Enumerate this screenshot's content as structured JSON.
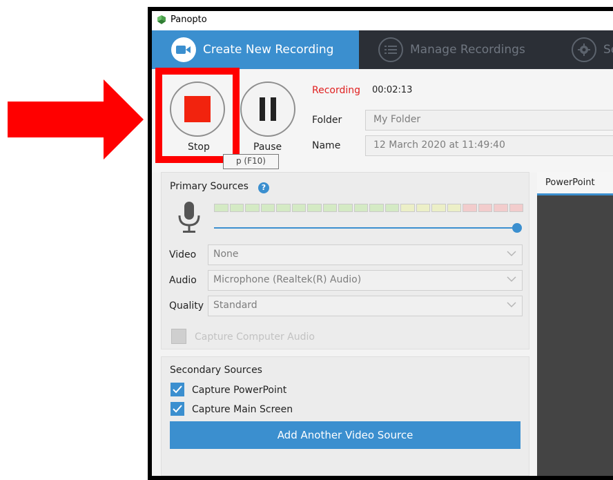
{
  "app": {
    "title": "Panopto"
  },
  "tabs": [
    {
      "label": "Create New Recording",
      "icon": "video-camera-icon",
      "active": true
    },
    {
      "label": "Manage Recordings",
      "icon": "list-icon",
      "active": false
    },
    {
      "label": "Se",
      "icon": "gear-icon",
      "active": false
    }
  ],
  "recording": {
    "stop_label": "Stop",
    "pause_label": "Pause",
    "stop_tooltip": "p (F10)",
    "status_label": "Recording",
    "elapsed": "00:02:13",
    "folder_label": "Folder",
    "folder_value": "My Folder",
    "name_label": "Name",
    "name_value": "12 March 2020 at 11:49:40"
  },
  "primary": {
    "title": "Primary Sources",
    "video_label": "Video",
    "video_value": "None",
    "audio_label": "Audio",
    "audio_value": "Microphone (Realtek(R) Audio)",
    "quality_label": "Quality",
    "quality_value": "Standard",
    "capture_computer_audio_label": "Capture Computer Audio",
    "capture_computer_audio_checked": false,
    "meter": {
      "segments": 20,
      "green": 12,
      "yellow": 4,
      "red": 4
    },
    "volume_level": 1.0
  },
  "secondary": {
    "title": "Secondary Sources",
    "capture_powerpoint_label": "Capture PowerPoint",
    "capture_powerpoint_checked": true,
    "capture_main_screen_label": "Capture Main Screen",
    "capture_main_screen_checked": true,
    "add_source_label": "Add Another Video Source"
  },
  "preview": {
    "tab_label": "PowerPoint"
  },
  "colors": {
    "accent": "#3b8fcf",
    "record_red": "#f2230e",
    "annotation_red": "#ff0000",
    "tabbar_dark": "#2b2f36",
    "meter_green": "#d4eac4",
    "meter_yellow": "#ecefc7",
    "meter_red": "#f2cccc"
  }
}
